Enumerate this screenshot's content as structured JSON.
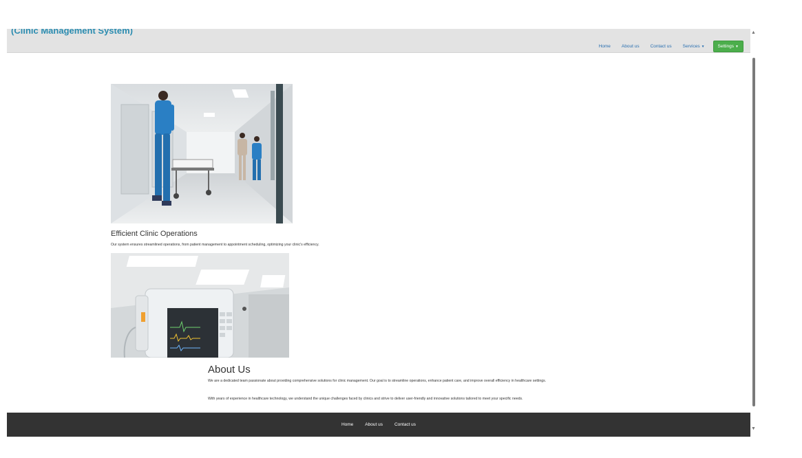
{
  "header": {
    "brand": "(Clinic Management System)",
    "nav": {
      "home": "Home",
      "about": "About us",
      "contact": "Contact us",
      "services": "Services",
      "settings": "Settings"
    }
  },
  "feature": {
    "title": "Efficient Clinic Operations",
    "text": "Our system ensures streamlined operations, from patient management to appointment scheduling, optimizing your clinic's efficiency."
  },
  "about": {
    "title": "About Us",
    "p1": "We are a dedicated team passionate about providing comprehensive solutions for clinic management. Our goal is to streamline operations, enhance patient care, and improve overall efficiency in healthcare settings.",
    "p2": "With years of experience in healthcare technology, we understand the unique challenges faced by clinics and strive to deliver user-friendly and innovative solutions tailored to meet your specific needs."
  },
  "footer": {
    "home": "Home",
    "about": "About us",
    "contact": "Contact us"
  },
  "icons": {
    "caret": "caret-down-icon",
    "scroll_up": "scroll-up-arrow-icon",
    "scroll_down": "scroll-down-arrow-icon"
  },
  "colors": {
    "brand": "#2b8cb0",
    "nav_link": "#2a6fb0",
    "settings_button": "#4cae4c",
    "footer_bg": "#333333",
    "navbar_bg": "#e3e3e3"
  }
}
